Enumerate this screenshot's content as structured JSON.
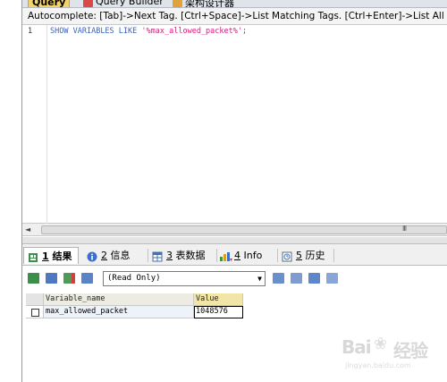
{
  "query_tabs": {
    "query": "Query",
    "builder": "Query Builder",
    "designer": "架构设计器"
  },
  "autocomplete_hint": "Autocomplete: [Tab]->Next Tag. [Ctrl+Space]->List Matching Tags. [Ctrl+Enter]->List All T",
  "editor": {
    "line_number": "1",
    "sql": {
      "keyword1": "SHOW",
      "keyword2": "VARIABLES",
      "keyword3": "LIKE",
      "string": "'%max_allowed_packet%'",
      "terminator": ";"
    }
  },
  "scrollbar": {
    "left_arrow": "◄",
    "grip": "III"
  },
  "result_tabs": [
    {
      "number": "1",
      "label": "结果",
      "icon": "grid-result-icon"
    },
    {
      "number": "2",
      "label": "信息",
      "icon": "info-icon"
    },
    {
      "number": "3",
      "label": "表数据",
      "icon": "table-data-icon"
    },
    {
      "number": "4",
      "label": "Info",
      "icon": "chart-info-icon"
    },
    {
      "number": "5",
      "label": "历史",
      "icon": "history-icon"
    }
  ],
  "result_toolbar": {
    "mode": "(Read Only)",
    "caret": "▼"
  },
  "grid": {
    "columns": [
      "Variable_name",
      "Value"
    ],
    "rows": [
      [
        "max_allowed_packet",
        "1048576"
      ]
    ]
  },
  "watermark": {
    "brand": "Bai",
    "paw": "❀",
    "brand_tail": "经验",
    "url": "jingyan.baidu.com"
  },
  "colors": {
    "accent_tab": "#f3d36a",
    "keyword": "#3a63c4",
    "string": "#d4217e",
    "value_header": "#f1e6a6"
  }
}
